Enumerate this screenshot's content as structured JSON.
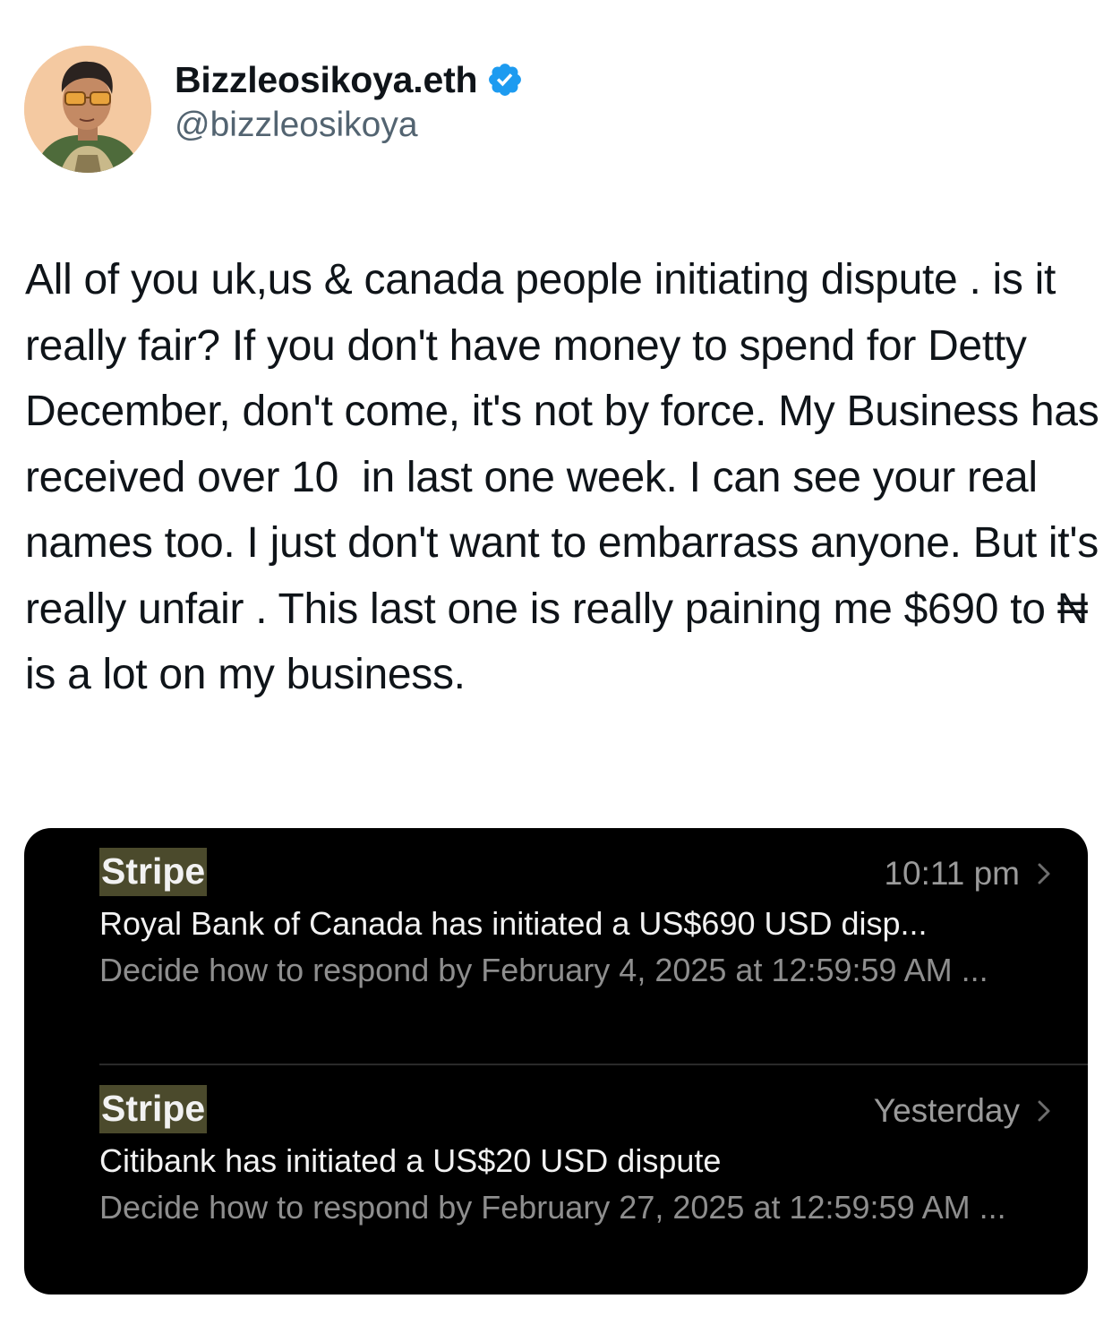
{
  "author": {
    "display_name": "Bizzleosikoya.eth",
    "handle": "@bizzleosikoya",
    "verified": true
  },
  "tweet": {
    "text": "All of you uk,us & canada people initiating dispute . is it really fair? If you don't have money to spend for Detty December, don't come, it's not by force. My Business has received over 10  in last one week. I can see your real names too. I just don't want to embarrass anyone. But it's really unfair . This last one is really paining me $690 to ₦ is a lot on my business."
  },
  "notifications": [
    {
      "sender": "Stripe",
      "time": "10:11 pm",
      "subject": "Royal Bank of Canada has initiated a US$690 USD disp...",
      "preview": "Decide how to respond by February 4, 2025 at 12:59:59 AM ..."
    },
    {
      "sender": "Stripe",
      "time": "Yesterday",
      "subject": "Citibank has initiated a US$20 USD dispute",
      "preview": "Decide how to respond by February 27, 2025 at 12:59:59 AM ..."
    }
  ],
  "colors": {
    "verified_badge": "#1d9bf0",
    "handle_text": "#536471",
    "sender_highlight": "#4b4a2c",
    "media_background": "#000000"
  },
  "icons": {
    "verified": "verified-badge-icon",
    "chevron": "chevron-right-icon"
  }
}
